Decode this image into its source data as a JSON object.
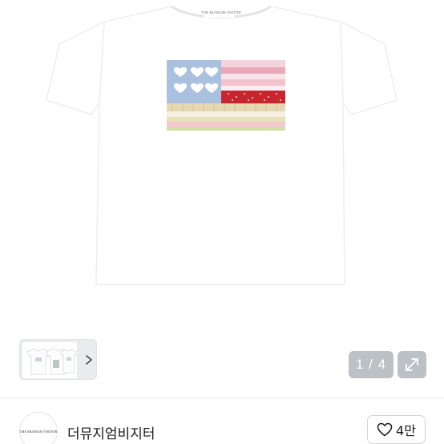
{
  "product": {
    "image_alt": "white t-shirt with patchwork flag",
    "shirt_label": "THE MUSEUM VISITOR"
  },
  "gallery": {
    "page_counter": "1 / 4",
    "current_page": 1,
    "total_pages": 4
  },
  "seller": {
    "avatar_text": "THE MUSEUM VISITOR",
    "name": "더뮤지엄비지터"
  },
  "like": {
    "count": "4만"
  },
  "colors": {
    "counter_bg": "#bcc1c6",
    "flag_blue": "#a9c1df",
    "flag_red": "#c8262e",
    "flag_pink": "#f0c3cf"
  },
  "icons": {
    "thumb_next": "chevron-right-icon",
    "expand": "expand-arrows-icon",
    "like": "heart-outline-icon"
  }
}
